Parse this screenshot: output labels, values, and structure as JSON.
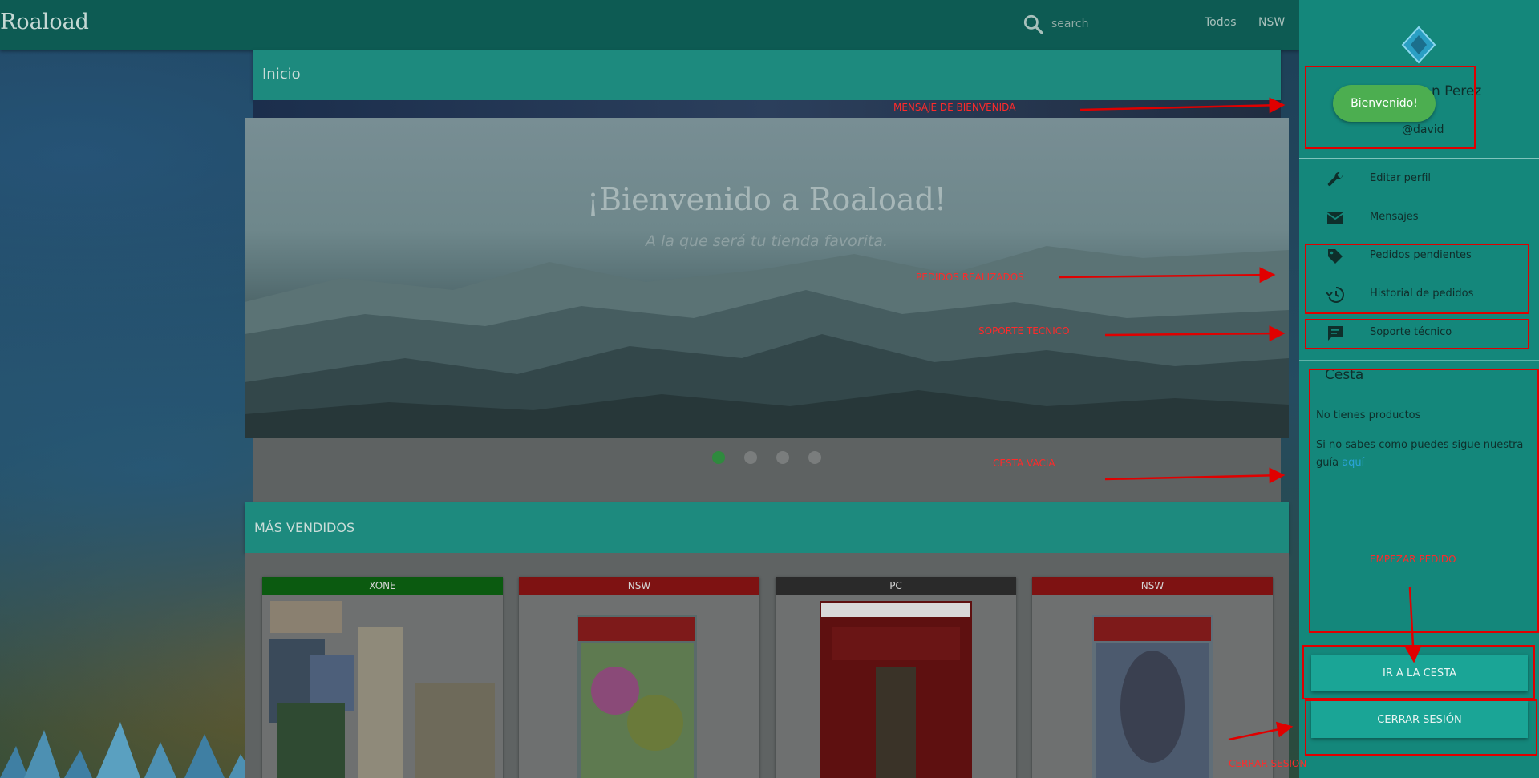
{
  "app": {
    "brand": "Roaload"
  },
  "topbar": {
    "search_placeholder": "search",
    "nav": [
      "Todos",
      "NSW"
    ]
  },
  "main": {
    "inicio_title": "Inicio",
    "hero_title": "¡Bienvenido a Roaload!",
    "hero_subtitle": "A la que será tu tienda favorita.",
    "carousel_active_index": 0,
    "carousel_count": 4,
    "bestsellers_title": "MÁS VENDIDOS",
    "products": [
      {
        "platform": "XONE",
        "tag_color": "#0b5a10"
      },
      {
        "platform": "NSW",
        "tag_color": "#7e1212"
      },
      {
        "platform": "PC",
        "tag_color": "#2a2a2a"
      },
      {
        "platform": "NSW",
        "tag_color": "#7e1212"
      }
    ]
  },
  "sidebar": {
    "profile_name": "n Perez",
    "profile_handle": "@david",
    "welcome_button": "Bienvenido!",
    "menu": [
      {
        "label": "Editar perfil",
        "icon": "wrench-icon"
      },
      {
        "label": "Mensajes",
        "icon": "mail-icon"
      },
      {
        "label": "Pedidos pendientes",
        "icon": "tag-icon"
      },
      {
        "label": "Historial de pedidos",
        "icon": "history-icon"
      },
      {
        "label": "Soporte técnico",
        "icon": "chat-icon"
      }
    ],
    "cart_title": "Cesta",
    "cart_empty": "No tienes productos",
    "cart_help_text": "Si no sabes como puedes sigue nuestra guía",
    "cart_help_link": "aquí",
    "go_cart_button": "IR A LA CESTA",
    "logout_button": "CERRAR SESIÓN"
  },
  "annotations": {
    "welcome": "MENSAJE DE BIENVENIDA",
    "orders": "PEDIDOS REALIZADOS",
    "support": "SOPORTE TECNICO",
    "cart_empty": "CESTA VACIA",
    "start_order": "EMPEZAR PEDIDO",
    "logout": "CERRAR SESION"
  },
  "colors": {
    "topbar": "#0d5b53",
    "panel": "#1d8a7e",
    "sidebar": "#14877b",
    "welcome_button": "#4cae50",
    "annotation": "#e00000"
  }
}
